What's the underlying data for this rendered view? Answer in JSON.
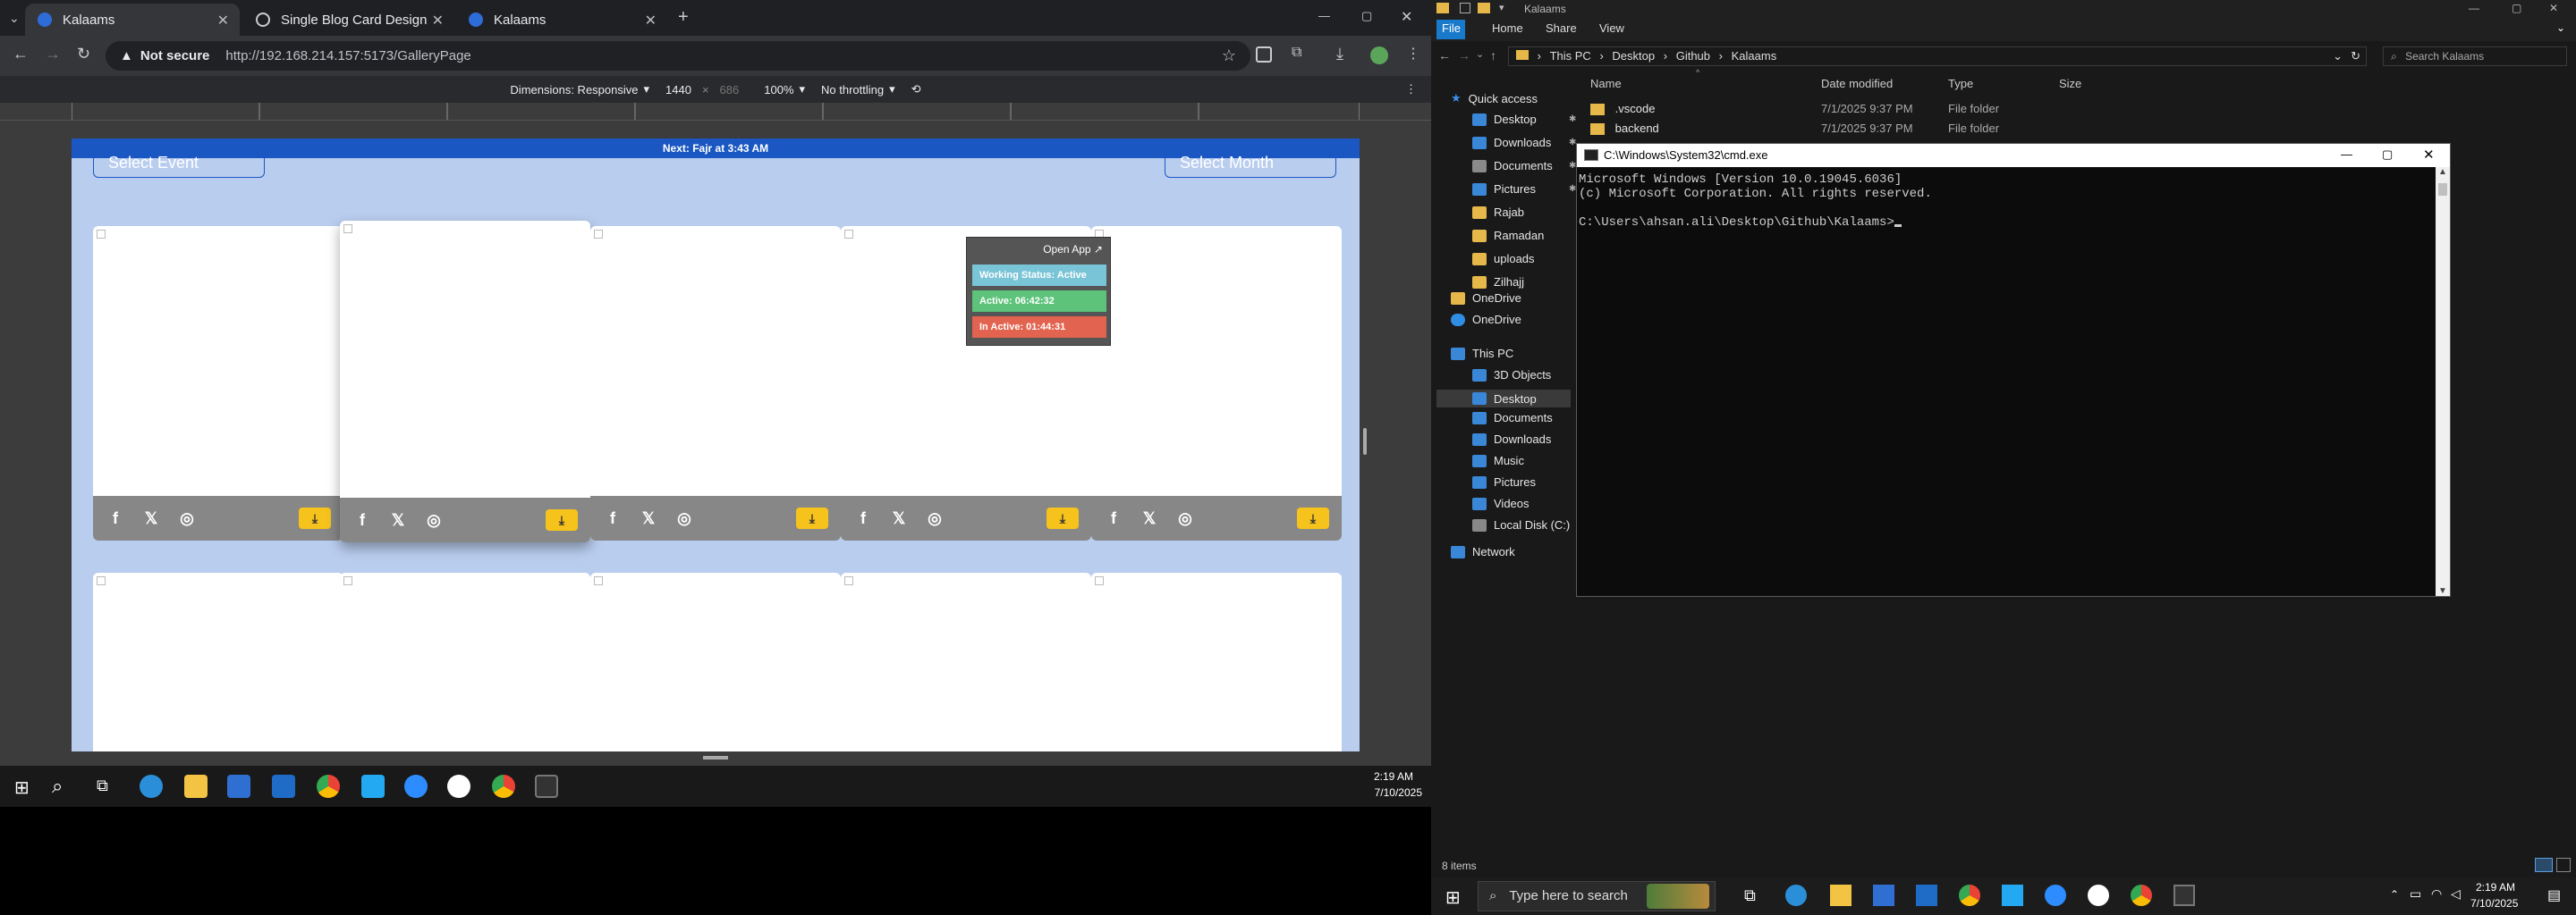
{
  "chrome": {
    "tabs": [
      {
        "title": "Kalaams",
        "active": true
      },
      {
        "title": "Single Blog Card Design",
        "active": false
      },
      {
        "title": "Kalaams",
        "active": false
      }
    ],
    "security": "Not secure",
    "url": "http://192.168.214.157:5173/GalleryPage",
    "devtools": {
      "dimensions_label": "Dimensions: Responsive",
      "width": "1440",
      "height": "686",
      "zoom": "100%",
      "throttle": "No throttling"
    }
  },
  "site": {
    "banner": "Next: Fajr at 3:43 AM",
    "select_event": "Select Event",
    "select_month": "Select Month",
    "popup": {
      "open_app": "Open App ↗",
      "working_status": "Working Status: Active",
      "active": "Active: 06:42:32",
      "inactive": "In Active: 01:44:31"
    }
  },
  "taskbar_left": {
    "time": "2:19 AM",
    "date": "7/10/2025"
  },
  "explorer": {
    "title": "Kalaams",
    "ribbon": [
      "File",
      "Home",
      "Share",
      "View"
    ],
    "breadcrumb": [
      "This PC",
      "Desktop",
      "Github",
      "Kalaams"
    ],
    "search_placeholder": "Search Kalaams",
    "columns": [
      "Name",
      "Date modified",
      "Type",
      "Size"
    ],
    "files": [
      {
        "name": ".vscode",
        "date": "7/1/2025 9:37 PM",
        "type": "File folder"
      },
      {
        "name": "backend",
        "date": "7/1/2025 9:37 PM",
        "type": "File folder"
      }
    ],
    "nav": {
      "quick_access": "Quick access",
      "quick_items": [
        "Desktop",
        "Downloads",
        "Documents",
        "Pictures",
        "Rajab",
        "Ramadan",
        "uploads",
        "Zilhajj"
      ],
      "onedrive1": "OneDrive",
      "onedrive2": "OneDrive",
      "this_pc": "This PC",
      "pc_items": [
        "3D Objects",
        "Desktop",
        "Documents",
        "Downloads",
        "Music",
        "Pictures",
        "Videos",
        "Local Disk (C:)"
      ],
      "network": "Network"
    },
    "status": "8 items"
  },
  "cmd": {
    "title": "C:\\Windows\\System32\\cmd.exe",
    "line1": "Microsoft Windows [Version 10.0.19045.6036]",
    "line2": "(c) Microsoft Corporation. All rights reserved.",
    "line3": "",
    "prompt": "C:\\Users\\ahsan.ali\\Desktop\\Github\\Kalaams>"
  },
  "taskbar_right": {
    "search_placeholder": "Type here to search",
    "time": "2:19 AM",
    "date": "7/10/2025"
  },
  "colors": {
    "site_bg": "#b9cdef",
    "banner": "#1a57c2",
    "download": "#f6c21c",
    "status_green": "#5dc37a",
    "status_red": "#e2634f",
    "status_blue": "#79c4d6"
  }
}
